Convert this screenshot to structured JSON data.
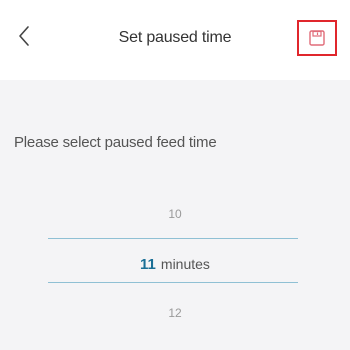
{
  "header": {
    "title": "Set paused time",
    "back_icon": "chevron-left-icon",
    "save_icon": "floppy-disk-icon"
  },
  "prompt": "Please select paused feed time",
  "picker": {
    "previous": "10",
    "selected": "11",
    "unit": "minutes",
    "next": "12"
  },
  "colors": {
    "accent": "#1a6f96",
    "save_highlight": "#e0262c",
    "divider": "#8fc0d4"
  }
}
